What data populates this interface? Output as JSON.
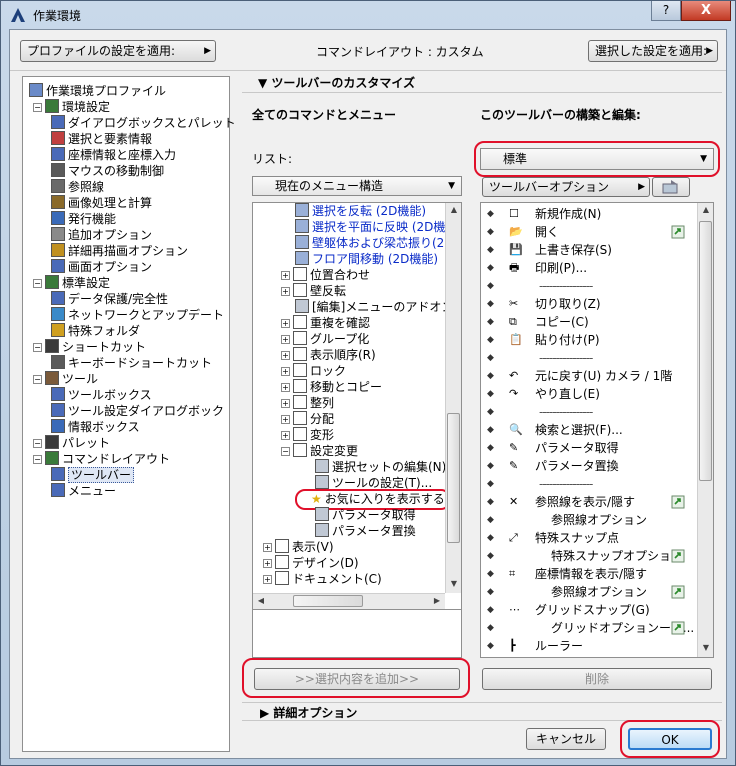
{
  "window": {
    "title": "作業環境",
    "help": "?",
    "close": "X"
  },
  "top": {
    "apply_profile": "プロファイルの設定を適用:",
    "command_layout": "コマンドレイアウト : カスタム",
    "apply_selected": "選択した設定を適用:"
  },
  "left_tree": {
    "root": "作業環境プロファイル",
    "items": [
      "環境設定",
      "ダイアログボックスとパレット",
      "選択と要素情報",
      "座標情報と座標入力",
      "マウスの移動制御",
      "参照線",
      "画像処理と計算",
      "発行機能",
      "追加オプション",
      "詳細再描画オプション",
      "画面オプション",
      "標準設定",
      "データ保護/完全性",
      "ネットワークとアップデート",
      "特殊フォルダ",
      "ショートカット",
      "キーボードショートカット",
      "ツール",
      "ツールボックス",
      "ツール設定ダイアログボック",
      "情報ボックス",
      "パレット",
      "コマンドレイアウト",
      "ツールバー",
      "メニュー"
    ]
  },
  "customize": {
    "header": "ツールバーのカスタマイズ",
    "all_commands": "全てのコマンドとメニュー",
    "build_edit": "このツールバーの構築と編集:",
    "list_label": "リスト:",
    "list_value": "現在のメニュー構造",
    "toolbar_value": "標準",
    "toolbar_options": "ツールバーオプション"
  },
  "commands_tree": [
    "選択を反転 (2D機能)",
    "選択を平面に反映 (2D機",
    "壁躯体および梁芯振り(2",
    "フロア間移動 (2D機能)",
    "位置合わせ",
    "壁反転",
    "[編集]メニューのアドオンこ",
    "重複を確認",
    "グループ化",
    "表示順序(R)",
    "ロック",
    "移動とコピー",
    "整列",
    "分配",
    "変形",
    "設定変更",
    "選択セットの編集(N)..",
    "ツールの設定(T)...",
    "お気に入りを表示する",
    "パラメータ取得",
    "パラメータ置換",
    "表示(V)",
    "デザイン(D)",
    "ドキュメント(C)"
  ],
  "toolbar_items": [
    {
      "type": "item",
      "text": "新規作成(N)"
    },
    {
      "type": "item",
      "text": "開く"
    },
    {
      "type": "item",
      "text": "上書き保存(S)"
    },
    {
      "type": "item",
      "text": "印刷(P)..."
    },
    {
      "type": "sep",
      "text": "----------------"
    },
    {
      "type": "item",
      "text": "切り取り(Z)"
    },
    {
      "type": "item",
      "text": "コピー(C)"
    },
    {
      "type": "item",
      "text": "貼り付け(P)"
    },
    {
      "type": "sep",
      "text": "----------------"
    },
    {
      "type": "item",
      "text": "元に戻す(U) カメラ / 1階"
    },
    {
      "type": "item",
      "text": "やり直し(E)"
    },
    {
      "type": "sep",
      "text": "----------------"
    },
    {
      "type": "item",
      "text": "検索と選択(F)..."
    },
    {
      "type": "item",
      "text": "パラメータ取得"
    },
    {
      "type": "item",
      "text": "パラメータ置換"
    },
    {
      "type": "sep",
      "text": "----------------"
    },
    {
      "type": "item",
      "text": "参照線を表示/隠す"
    },
    {
      "type": "sub",
      "text": "参照線オプション"
    },
    {
      "type": "item",
      "text": "特殊スナップ点"
    },
    {
      "type": "sub",
      "text": "特殊スナップオプション"
    },
    {
      "type": "item",
      "text": "座標情報を表示/隠す"
    },
    {
      "type": "sub",
      "text": "参照線オプション"
    },
    {
      "type": "item",
      "text": "グリッドスナップ(G)"
    },
    {
      "type": "sub",
      "text": "グリッドオプションーツ..."
    },
    {
      "type": "item",
      "text": "ルーラー"
    }
  ],
  "buttons": {
    "add_selected": ">>選択内容を追加>>",
    "delete": "削除",
    "advanced": "詳細オプション",
    "cancel": "キャンセル",
    "ok": "OK"
  }
}
